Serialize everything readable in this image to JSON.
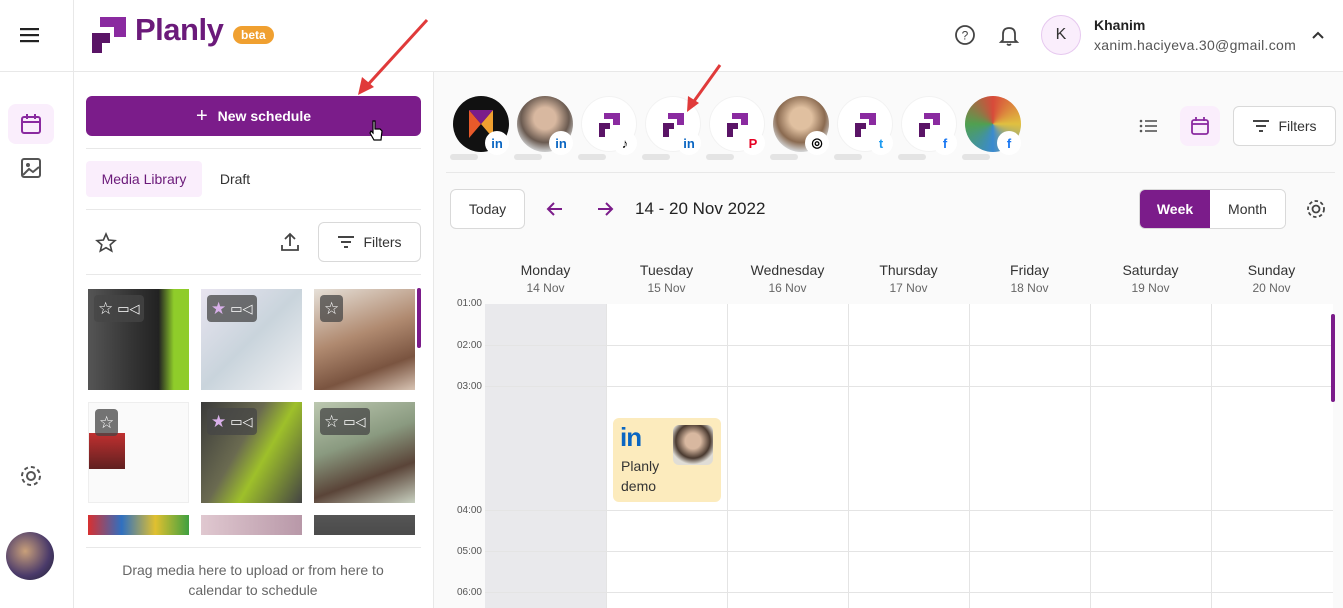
{
  "app": {
    "name": "Planly",
    "badge": "beta"
  },
  "user": {
    "initial": "K",
    "name": "Khanim",
    "email": "xanim.haciyeva.30@gmail.com"
  },
  "sidebar": {
    "icons": [
      "menu-icon",
      "calendar-icon",
      "image-icon",
      "settings-icon"
    ]
  },
  "media": {
    "new_schedule": "New schedule",
    "tabs": [
      "Media Library",
      "Draft"
    ],
    "filters": "Filters",
    "drag_text": "Drag media here to upload or from here to calendar to schedule"
  },
  "accounts": [
    {
      "network": "linkedin",
      "badge": "in",
      "color": "#0a66c2"
    },
    {
      "network": "linkedin",
      "badge": "in",
      "color": "#0a66c2"
    },
    {
      "network": "tiktok",
      "badge": "♪",
      "color": "#000000"
    },
    {
      "network": "linkedin",
      "badge": "in",
      "color": "#0a66c2"
    },
    {
      "network": "pinterest",
      "badge": "P",
      "color": "#e60023"
    },
    {
      "network": "instagram",
      "badge": "◎",
      "color": "#000000"
    },
    {
      "network": "twitter",
      "badge": "t",
      "color": "#1d9bf0"
    },
    {
      "network": "facebook",
      "badge": "f",
      "color": "#1877f2"
    },
    {
      "network": "facebook",
      "badge": "f",
      "color": "#1877f2"
    }
  ],
  "calendar": {
    "filters": "Filters",
    "today": "Today",
    "range": "14 - 20 Nov 2022",
    "views": [
      "Week",
      "Month"
    ],
    "days": [
      {
        "name": "Monday",
        "date": "14 Nov"
      },
      {
        "name": "Tuesday",
        "date": "15 Nov"
      },
      {
        "name": "Wednesday",
        "date": "16 Nov"
      },
      {
        "name": "Thursday",
        "date": "17 Nov"
      },
      {
        "name": "Friday",
        "date": "18 Nov"
      },
      {
        "name": "Saturday",
        "date": "19 Nov"
      },
      {
        "name": "Sunday",
        "date": "20 Nov"
      }
    ],
    "times": [
      "01:00",
      "02:00",
      "03:00",
      "04:00",
      "05:00",
      "06:00"
    ],
    "event": {
      "network": "in",
      "title": "Planly demo"
    }
  },
  "colors": {
    "brand": "#7b1c8a",
    "beta": "#f0a030",
    "event": "#fcebbd",
    "linkedin": "#0a66c2"
  }
}
